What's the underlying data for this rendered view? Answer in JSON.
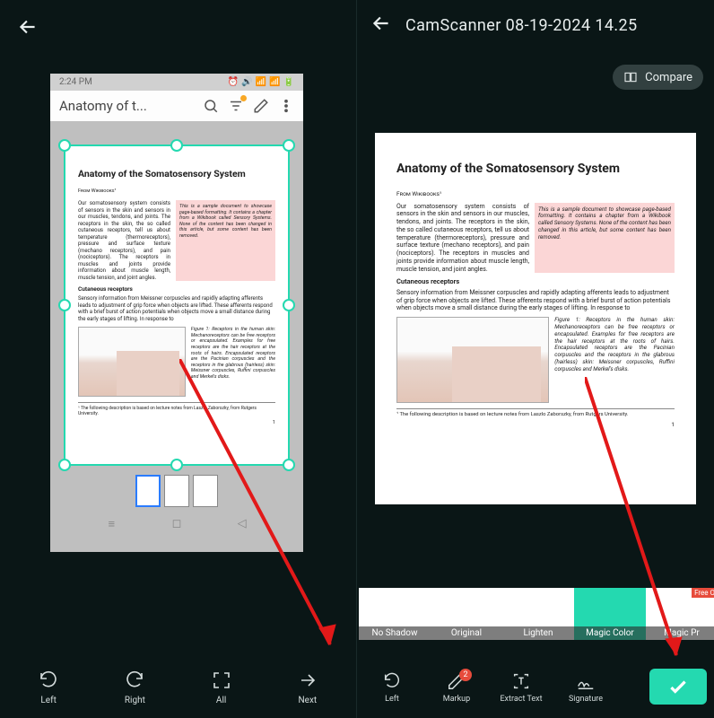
{
  "left": {
    "status_time": "2:24 PM",
    "app_title": "Anatomy of t...",
    "bottom": {
      "left": "Left",
      "right": "Right",
      "all": "All",
      "next": "Next"
    }
  },
  "right": {
    "title": "CamScanner 08-19-2024 14.25",
    "compare": "Compare",
    "filters": {
      "f0": "No Shadow",
      "f1": "Original",
      "f2": "Lighten",
      "f3": "Magic Color",
      "f4": "Magic Pr",
      "free_badge": "Free O"
    },
    "bottom": {
      "left": "Left",
      "markup": "Markup",
      "markup_badge": "2",
      "extract": "Extract Text",
      "signature": "Signature"
    }
  },
  "document": {
    "title": "Anatomy of the Somatosensory System",
    "from": "From Wikibooks¹",
    "p1": "Our somatosensory system consists of sensors in the skin and sensors in our muscles, tendons, and joints. The receptors in the skin, the so called cutaneous receptors, tell us about temperature (thermoreceptors), pressure and surface texture (mechano receptors), and pain (nociceptors). The receptors in muscles and joints provide information about muscle length, muscle tension, and joint angles.",
    "sidebox": "This is a sample document to showcase page-based formatting. It contains a chapter from a Wikibook called Sensory Systems. None of the content has been changed in this article, but some content has been removed.",
    "heading2": "Cutaneous receptors",
    "p2": "Sensory information from Meissner corpuscles and rapidly adapting afferents leads to adjustment of grip force when objects are lifted. These afferents respond with a brief burst of action potentials when objects move a small distance during the early stages of lifting. In response to",
    "figcaption": "Figure 1: Receptors in the human skin: Mechanoreceptors can be free receptors or encapsulated. Examples for free receptors are the hair receptors at the roots of hairs. Encapsulated receptors are the Pacinian corpuscles and the receptors in the glabrous (hairless) skin: Meissner corpuscles, Ruffini corpuscles and Merkel's disks.",
    "footnote": "¹ The following description is based on lecture notes from Laszlo Zaborszky, from Rutgers University.",
    "pagenum": "1"
  }
}
